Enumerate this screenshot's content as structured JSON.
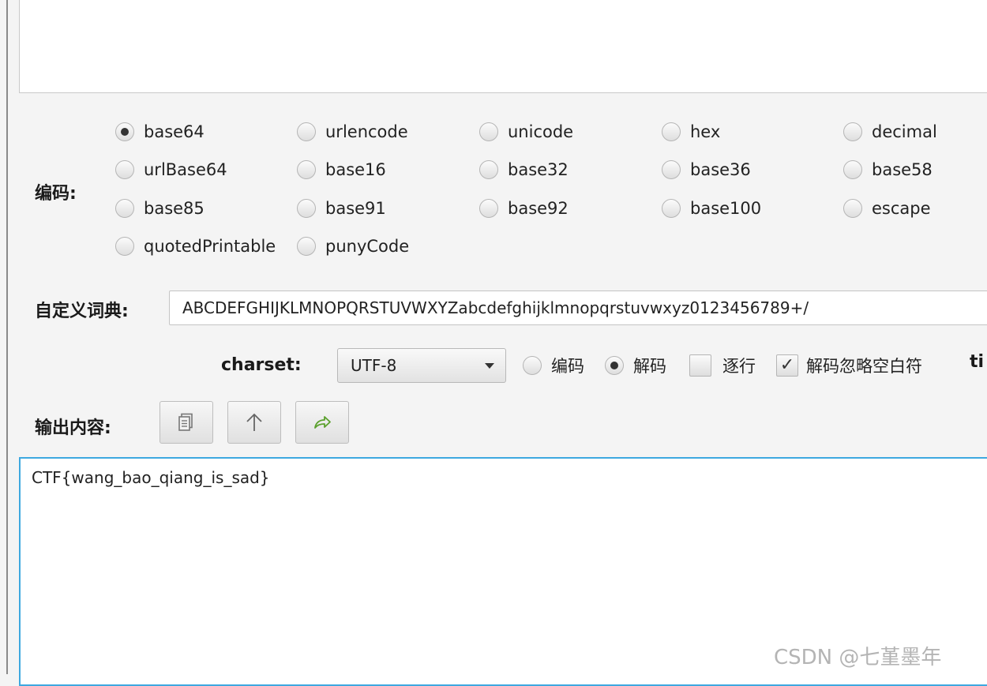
{
  "encoding": {
    "label": "编码:",
    "options": [
      {
        "label": "base64",
        "checked": true
      },
      {
        "label": "urlencode",
        "checked": false
      },
      {
        "label": "unicode",
        "checked": false
      },
      {
        "label": "hex",
        "checked": false
      },
      {
        "label": "decimal",
        "checked": false
      },
      {
        "label": "urlBase64",
        "checked": false
      },
      {
        "label": "base16",
        "checked": false
      },
      {
        "label": "base32",
        "checked": false
      },
      {
        "label": "base36",
        "checked": false
      },
      {
        "label": "base58",
        "checked": false
      },
      {
        "label": "base85",
        "checked": false
      },
      {
        "label": "base91",
        "checked": false
      },
      {
        "label": "base92",
        "checked": false
      },
      {
        "label": "base100",
        "checked": false
      },
      {
        "label": "escape",
        "checked": false
      },
      {
        "label": "quotedPrintable",
        "checked": false
      },
      {
        "label": "punyCode",
        "checked": false
      }
    ]
  },
  "dictionary": {
    "label": "自定义词典:",
    "value": "ABCDEFGHIJKLMNOPQRSTUVWXYZabcdefghijklmnopqrstuvwxyz0123456789+/"
  },
  "charset": {
    "label": "charset:",
    "selected": "UTF-8",
    "mode_encode": "编码",
    "mode_decode": "解码",
    "mode_selected": "decode",
    "line_by_line": {
      "label": "逐行",
      "checked": false
    },
    "ignore_whitespace": {
      "label": "解码忽略空白符",
      "checked": true
    },
    "cut_text": "ti"
  },
  "output": {
    "label": "输出内容:",
    "buttons": [
      {
        "icon": "copy-icon"
      },
      {
        "icon": "arrow-up-icon"
      },
      {
        "icon": "share-arrow-icon",
        "color": "#5aa02c"
      }
    ],
    "text": "CTF{wang_bao_qiang_is_sad}"
  },
  "watermark": "CSDN @七堇墨年"
}
